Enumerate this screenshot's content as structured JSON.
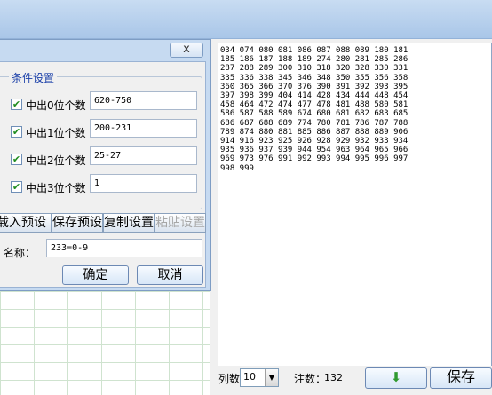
{
  "dialog": {
    "close_label": "x",
    "group_title": "条件设置",
    "conditions": [
      {
        "label": "中出0位个数",
        "value": "620-750",
        "checked": true
      },
      {
        "label": "中出1位个数",
        "value": "200-231",
        "checked": true
      },
      {
        "label": "中出2位个数",
        "value": "25-27",
        "checked": true
      },
      {
        "label": "中出3位个数",
        "value": "1",
        "checked": true
      }
    ],
    "toolbar": {
      "load": "载入预设",
      "save": "保存预设",
      "copy": "复制设置",
      "paste": "粘贴设置"
    },
    "name_label": "名称：",
    "name_value": "233=0-9",
    "ok": "确定",
    "cancel": "取消",
    "check_mark": "✔"
  },
  "output": {
    "lines": "034 074 080 081 086 087 088 089 180 181\n185 186 187 188 189 274 280 281 285 286\n287 288 289 300 310 318 320 328 330 331\n335 336 338 345 346 348 350 355 356 358\n360 365 366 370 376 390 391 392 393 395\n397 398 399 404 414 428 434 444 448 454\n458 464 472 474 477 478 481 488 580 581\n586 587 588 589 674 680 681 682 683 685\n686 687 688 689 774 780 781 786 787 788\n789 874 880 881 885 886 887 888 889 906\n914 916 923 925 926 928 929 932 933 934\n935 936 937 939 944 954 963 964 965 966\n969 973 976 991 992 993 994 995 996 997\n998 999"
  },
  "bottom": {
    "columns_label": "列数",
    "columns_value": "10",
    "count_label": "注数：",
    "count_value": "132",
    "save_label": "保存",
    "down_arrow": "⬇",
    "dropdown_arrow": "▼"
  }
}
